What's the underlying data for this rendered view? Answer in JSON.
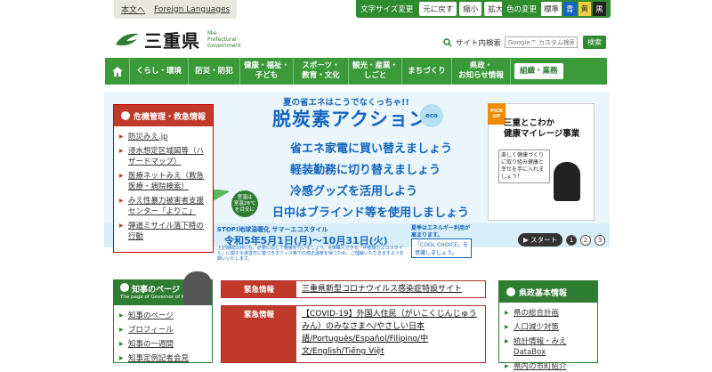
{
  "topbar": {
    "text_version": "本文へ",
    "foreign": "Foreign Languages",
    "font_size_label": "文字サイズ変更",
    "font_buttons": [
      "元に戻す",
      "縮小",
      "拡大"
    ],
    "color_label": "色の変更",
    "color_buttons": [
      "標準",
      "青",
      "黄",
      "黒"
    ],
    "color_values": [
      "#ffffff",
      "#1565c0",
      "#f4d03f",
      "#222222"
    ]
  },
  "logo": {
    "jp": "三重県",
    "en_lines": [
      "Mie",
      "Prefectural",
      "Government"
    ]
  },
  "search": {
    "label": "サイト内検索",
    "placeholder": "Google™ カスタム検索",
    "button": "検索"
  },
  "nav": {
    "items": [
      "くらし・環境",
      "防災・防犯",
      "健康・福祉・\n子ども",
      "スポーツ・\n教育・文化",
      "観光・産業・\nしごと",
      "まちづくり",
      "県政・\nお知らせ情報"
    ],
    "biz": "組織・業務"
  },
  "crisis": {
    "title": "危機管理・救急情報",
    "links": [
      "防災みえ.jp",
      "浸水想定区域図等（ハザードマップ）",
      "医療ネットみえ（救急医療・病院検索）",
      "みえ性暴力被害者支援センター「よりこ」",
      "弾道ミサイル落下時の行動"
    ]
  },
  "banner": {
    "top": "夏の省エネはこうでなくっちゃ!!",
    "title": "脱炭素アクション",
    "eco": "eco",
    "lines": [
      "省エネ家電に買い替えましょう",
      "軽装勤務に切り替えましょう",
      "冷感グッズを活用しよう",
      "日中はブラインド等を使用しましょう"
    ],
    "thermo": "室温は\n室温28℃\nを目安に",
    "bottom1": "STOP!地球温暖化 サマーエコスタイル",
    "bottom2": "令和5年5月1日(月)～10月31日(火)",
    "small": "上記期間以外にも、必要に応じて軽装を行いましょう。※御購入できる「中部電力エコスタイル」に関する運営方に基づきオフィス等での適正温度を保つため、ご理解いただきますようお願いいたします。",
    "right1": "夏季はエネルギー利用が\n高まります。",
    "cool": "「COOL CHOICE」を\n意識しましょう。",
    "pickup_tag": "PICK\nUP",
    "pickup_title": "三重とこわか\n健康マイレージ事業",
    "pickup_sub": "楽しく健康づくりに取り組み健康と幸せを手に入れましょう！",
    "start": "スタート",
    "dots": [
      "1",
      "2",
      "3"
    ]
  },
  "governor": {
    "title": "知事のページ",
    "subtitle": "The page of Governor of Mie",
    "links": [
      "知事のページ",
      "プロフィール",
      "知事の一週間",
      "知事定例記者会見"
    ]
  },
  "emergency": [
    {
      "tag": "緊急情報",
      "text": "三重県新型コロナウイルス感染症特設サイト"
    },
    {
      "tag": "緊急情報",
      "text": "【COVID-19】外国人住民（がいこくじんじゅうみん）のみなさまへ/やさしい日本語/Português/Español/Filipino/中文/English/Tiếng Việt"
    }
  ],
  "pref": {
    "title": "県政基本情報",
    "links": [
      "県の総合計画",
      "人口減少対策",
      "統計情報・みえDataBox",
      "県内の市町紹介"
    ]
  }
}
